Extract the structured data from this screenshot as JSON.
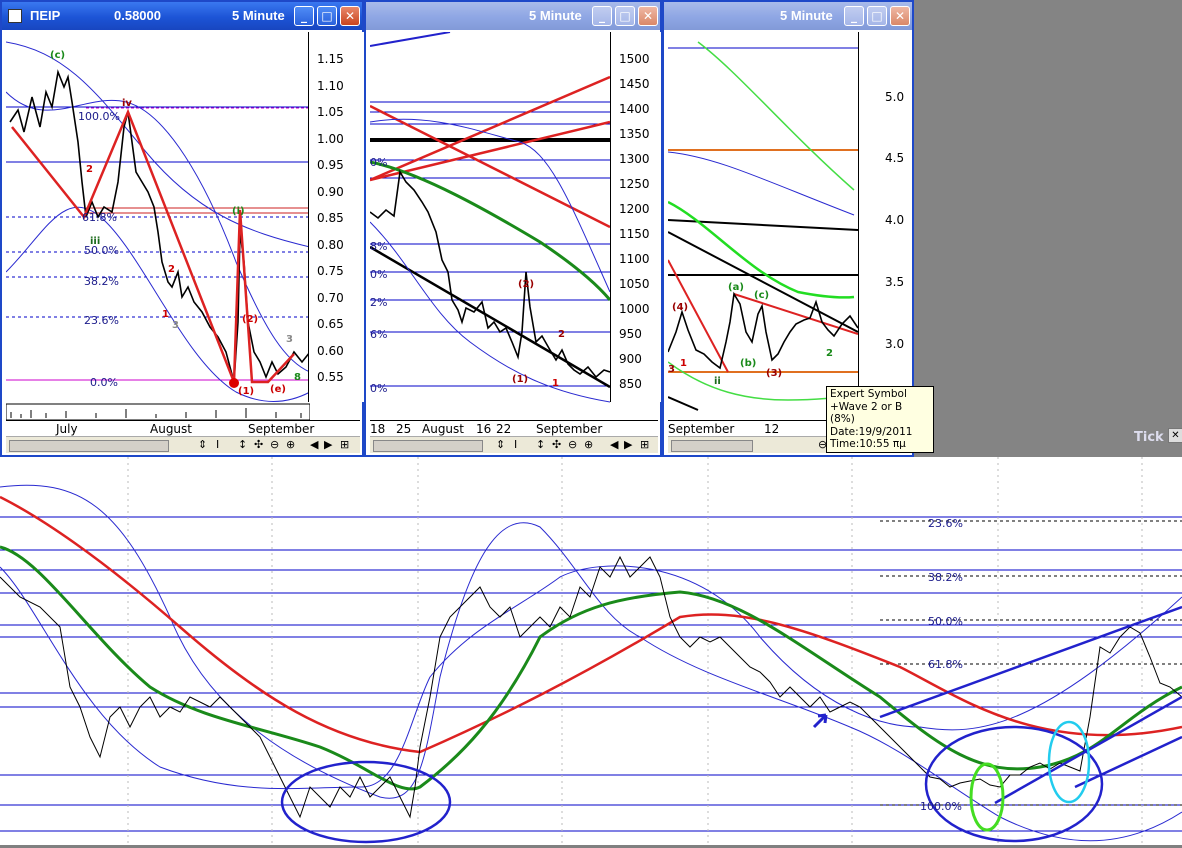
{
  "windows": [
    {
      "title_symbol": "ΠΕΙΡ",
      "title_price": "0.58000",
      "title_interval": "5 Minute",
      "yaxis": [
        "1.15",
        "1.10",
        "1.05",
        "1.00",
        "0.95",
        "0.90",
        "0.85",
        "0.80",
        "0.75",
        "0.70",
        "0.65",
        "0.60",
        "0.55"
      ],
      "xaxis": [
        "July",
        "August",
        "September"
      ],
      "fib_labels": [
        "100.0%",
        "61.8%",
        "50.0%",
        "38.2%",
        "23.6%",
        "0.0%"
      ],
      "wave_labels": [
        "(c)",
        "iv",
        "iii",
        "(i)",
        "2",
        "2",
        "1",
        "3",
        "3",
        "(1)",
        "(2)",
        "(e)",
        "8"
      ]
    },
    {
      "title_interval": "5 Minute",
      "yaxis": [
        "1500",
        "1450",
        "1400",
        "1350",
        "1300",
        "1250",
        "1200",
        "1150",
        "1100",
        "1050",
        "1000",
        "950",
        "900",
        "850"
      ],
      "xaxis": [
        "18",
        "25",
        "August",
        "16",
        "22",
        "September"
      ],
      "fib_labels": [
        "0%",
        "8%",
        "0%",
        "2%",
        "6%",
        "0%"
      ],
      "wave_labels": [
        "(2)",
        "(1)",
        "2",
        "1"
      ]
    },
    {
      "title_interval": "5 Minute",
      "yaxis": [
        "5.0",
        "4.5",
        "4.0",
        "3.5",
        "3.0"
      ],
      "xaxis": [
        "September",
        "12"
      ],
      "wave_labels": [
        "(4)",
        "(a)",
        "(c)",
        "(b)",
        "ii",
        "(3)",
        "2",
        "1",
        "3"
      ]
    }
  ],
  "tooltip": {
    "line1": "Expert Symbol",
    "line2": "+Wave 2 or B (8%)",
    "line3": "Date:19/9/2011",
    "line4": "Time:10:55 πμ"
  },
  "main": {
    "interval_label": "Tick",
    "fib_labels": [
      "23.6%",
      "38.2%",
      "50.0%",
      "61.8%",
      "100.0%"
    ]
  },
  "toolbar": {
    "icons": [
      "cursor-icon",
      "crosshair-icon",
      "move-icon",
      "zoom-out-icon",
      "zoom-in-icon",
      "scroll-left-icon",
      "scroll-right-icon",
      "grid-icon"
    ]
  },
  "colors": {
    "titlebar": "#2a5fe0",
    "ma_red": "#dd2222",
    "ma_green": "#1a8a1a",
    "bands": "#2a2ad0",
    "fib": "#0000c8",
    "wave": "#cc0000"
  }
}
